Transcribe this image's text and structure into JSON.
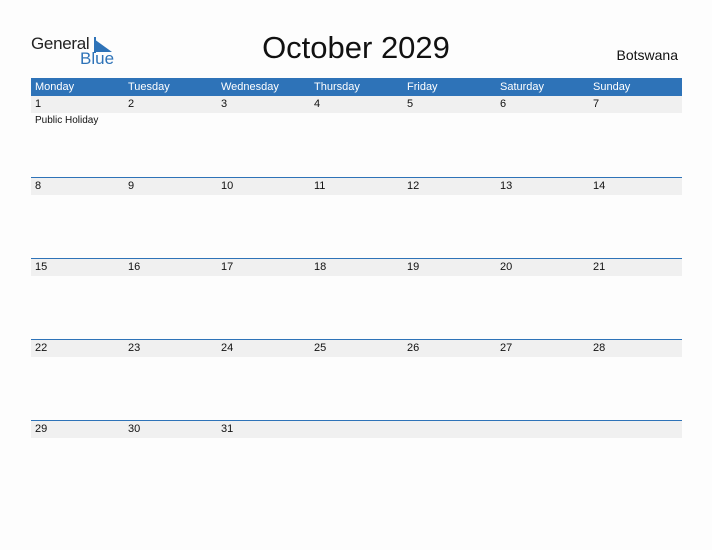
{
  "logo": {
    "line1": "General",
    "line2": "Blue"
  },
  "title": "October 2029",
  "country": "Botswana",
  "colors": {
    "accent": "#2e73b8",
    "band": "#f0f0f0"
  },
  "weekdays": [
    "Monday",
    "Tuesday",
    "Wednesday",
    "Thursday",
    "Friday",
    "Saturday",
    "Sunday"
  ],
  "weeks": [
    {
      "days": [
        "1",
        "2",
        "3",
        "4",
        "5",
        "6",
        "7"
      ],
      "events": [
        "Public Holiday",
        "",
        "",
        "",
        "",
        "",
        ""
      ]
    },
    {
      "days": [
        "8",
        "9",
        "10",
        "11",
        "12",
        "13",
        "14"
      ],
      "events": [
        "",
        "",
        "",
        "",
        "",
        "",
        ""
      ]
    },
    {
      "days": [
        "15",
        "16",
        "17",
        "18",
        "19",
        "20",
        "21"
      ],
      "events": [
        "",
        "",
        "",
        "",
        "",
        "",
        ""
      ]
    },
    {
      "days": [
        "22",
        "23",
        "24",
        "25",
        "26",
        "27",
        "28"
      ],
      "events": [
        "",
        "",
        "",
        "",
        "",
        "",
        ""
      ]
    },
    {
      "days": [
        "29",
        "30",
        "31",
        "",
        "",
        "",
        ""
      ],
      "events": [
        "",
        "",
        "",
        "",
        "",
        "",
        ""
      ]
    }
  ]
}
